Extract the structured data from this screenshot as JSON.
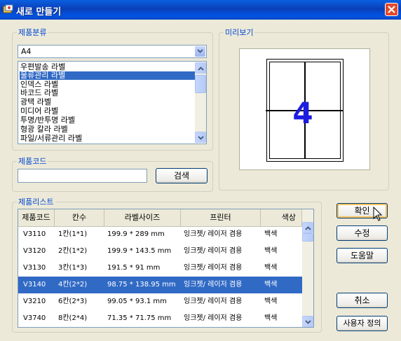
{
  "window": {
    "title": "새로 만들기",
    "title_icon": "app-icon",
    "accent": "#0054E3"
  },
  "category": {
    "legend": "제품분류",
    "selected_value": "A4",
    "items": [
      {
        "label": "우편발송 라벨",
        "selected": false
      },
      {
        "label": "물류관리 라벨",
        "selected": true
      },
      {
        "label": "인덱스 라벨",
        "selected": false
      },
      {
        "label": "바코드 라벨",
        "selected": false
      },
      {
        "label": "광택 라벨",
        "selected": false
      },
      {
        "label": "미디어 라벨",
        "selected": false
      },
      {
        "label": "투명/반투명 라벨",
        "selected": false
      },
      {
        "label": "형광 칼라 라벨",
        "selected": false
      },
      {
        "label": "파일/서류관리 라벨",
        "selected": false
      }
    ]
  },
  "product_code": {
    "legend": "제품코드",
    "value": "",
    "search_label": "검색"
  },
  "preview": {
    "legend": "미리보기",
    "label_count": "4"
  },
  "product_list": {
    "legend": "제품리스트",
    "columns": [
      "제품코드",
      "칸수",
      "라벨사이즈",
      "프린터",
      "색상"
    ],
    "rows": [
      {
        "code": "V3110",
        "cells": "1칸(1*1)",
        "size": "199.9 * 289 mm",
        "printer": "잉크젯/ 레이저 겸용",
        "color": "백색",
        "selected": false
      },
      {
        "code": "V3120",
        "cells": "2칸(1*2)",
        "size": "199.9 * 143.5 mm",
        "printer": "잉크젯/ 레이저 겸용",
        "color": "백색",
        "selected": false
      },
      {
        "code": "V3130",
        "cells": "3칸(1*3)",
        "size": "191.5 * 91 mm",
        "printer": "잉크젯/ 레이저 겸용",
        "color": "백색",
        "selected": false
      },
      {
        "code": "V3140",
        "cells": "4칸(2*2)",
        "size": "98.75 * 138.95 mm",
        "printer": "잉크젯/ 레이저 겸용",
        "color": "백색",
        "selected": true
      },
      {
        "code": "V3210",
        "cells": "6칸(2*3)",
        "size": "99.05 * 93.1 mm",
        "printer": "잉크젯/ 레이저 겸용",
        "color": "백색",
        "selected": false
      },
      {
        "code": "V3740",
        "cells": "8칸(2*4)",
        "size": "71.35 * 71.75 mm",
        "printer": "잉크젯/ 레이저 겸용",
        "color": "백색",
        "selected": false
      }
    ]
  },
  "buttons": {
    "ok": "확인",
    "edit": "수정",
    "help": "도움말",
    "cancel": "취소",
    "user_define": "사용자 정의"
  }
}
